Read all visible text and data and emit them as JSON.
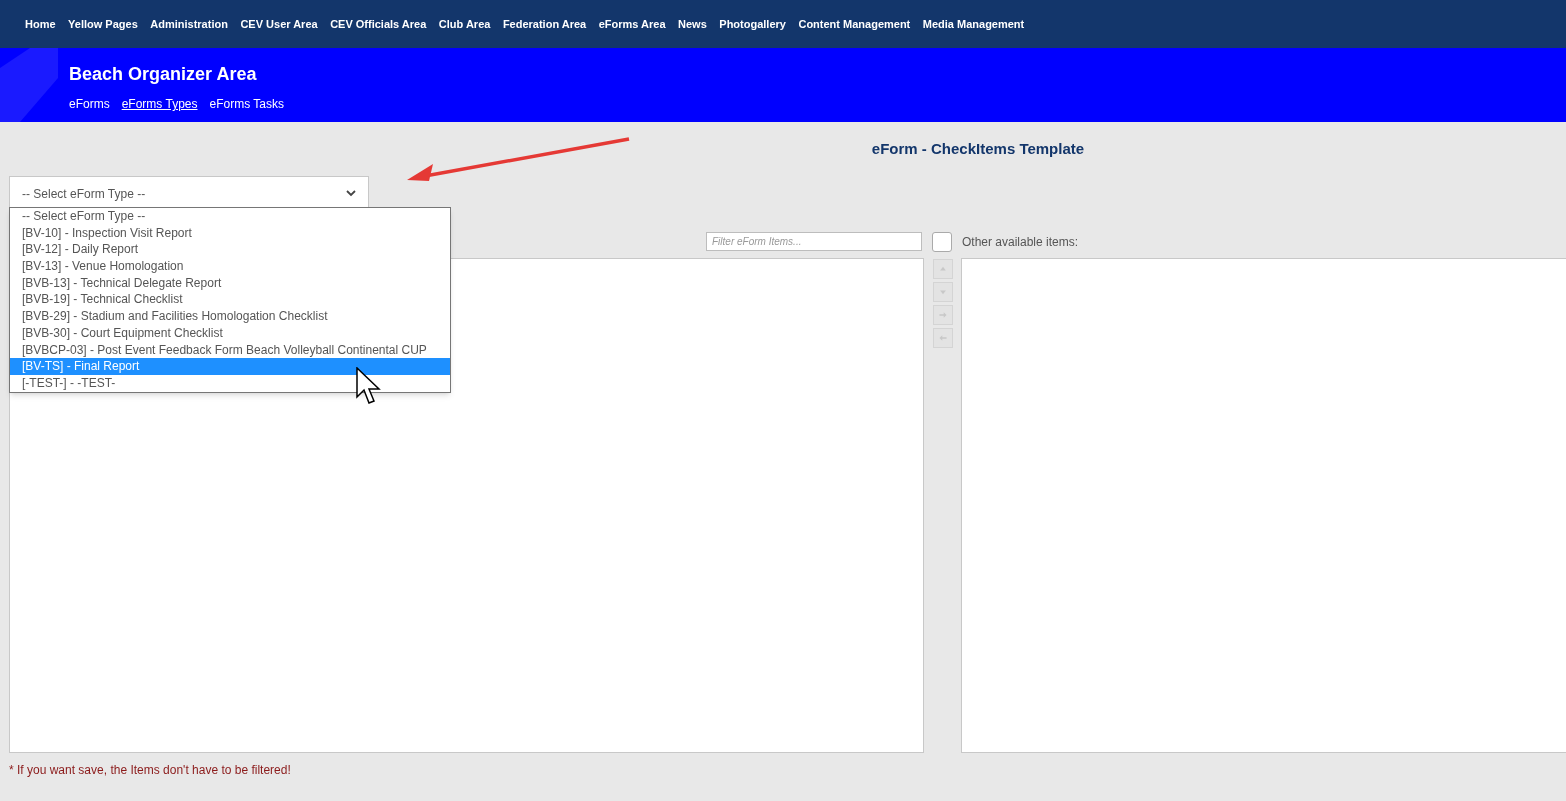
{
  "top_nav": [
    "Home",
    "Yellow Pages",
    "Administration",
    "CEV User Area",
    "CEV Officials Area",
    "Club Area",
    "Federation Area",
    "eForms Area",
    "News",
    "Photogallery",
    "Content Management",
    "Media Management"
  ],
  "area": {
    "title": "Beach Organizer Area",
    "links": [
      {
        "label": "eForms",
        "selected": false
      },
      {
        "label": "eForms Types",
        "selected": true
      },
      {
        "label": "eForms Tasks",
        "selected": false
      }
    ]
  },
  "page_title": "eForm - CheckItems Template",
  "type_select": {
    "value": "-- Select eForm Type --",
    "expanded": true,
    "options": [
      {
        "label": "-- Select eForm Type --",
        "highlighted": false
      },
      {
        "label": "[BV-10] - Inspection Visit Report",
        "highlighted": false
      },
      {
        "label": "[BV-12] - Daily Report",
        "highlighted": false
      },
      {
        "label": "[BV-13] - Venue Homologation",
        "highlighted": false
      },
      {
        "label": "[BVB-13] - Technical Delegate Report",
        "highlighted": false
      },
      {
        "label": "[BVB-19] - Technical Checklist",
        "highlighted": false
      },
      {
        "label": "[BVB-29] - Stadium and Facilities Homologation Checklist",
        "highlighted": false
      },
      {
        "label": "[BVB-30] - Court Equipment Checklist",
        "highlighted": false
      },
      {
        "label": "[BVBCP-03] - Post Event Feedback Form Beach Volleyball Continental CUP",
        "highlighted": false
      },
      {
        "label": "[BV-TS] - Final Report",
        "highlighted": true
      },
      {
        "label": "[-TEST-] - -TEST-",
        "highlighted": false
      }
    ]
  },
  "filter": {
    "placeholder": "Filter eForm Items..."
  },
  "select_all": {
    "checked": false
  },
  "other_items_label": "Other available items:",
  "move_buttons": [
    {
      "kind": "up",
      "disabled": true
    },
    {
      "kind": "down",
      "disabled": true
    },
    {
      "kind": "right",
      "disabled": true
    },
    {
      "kind": "left",
      "disabled": true
    }
  ],
  "note": "* If you want save, the Items don't have to be filtered!"
}
